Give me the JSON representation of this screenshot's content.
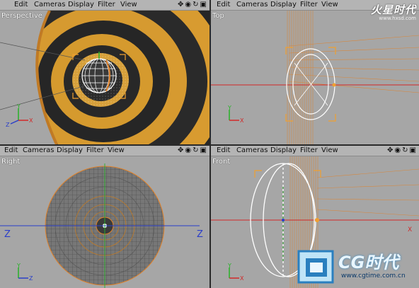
{
  "menu": [
    "Edit",
    "Cameras",
    "Display",
    "Filter",
    "View"
  ],
  "nav_icons": [
    "move-icon",
    "zoom-icon",
    "rotate-icon",
    "maximize-icon"
  ],
  "viewports": {
    "tl": {
      "label": "Perspective"
    },
    "tr": {
      "label": "Top"
    },
    "bl": {
      "label": "Right"
    },
    "br": {
      "label": "Front"
    }
  },
  "axis": {
    "x": "X",
    "y": "Y",
    "z": "Z"
  },
  "watermarks": {
    "top_logo": "火星时代",
    "top_url": "www.hxsd.com",
    "bottom_logo": "CG时代",
    "bottom_url": "www.cgtime.com.cn"
  },
  "colors": {
    "viewport_bg": "#a6a6a6",
    "orange": "#e0822a",
    "wire": "#ffffff",
    "x_axis": "#d22828",
    "y_axis": "#27b227",
    "z_axis": "#2a3ec9"
  }
}
